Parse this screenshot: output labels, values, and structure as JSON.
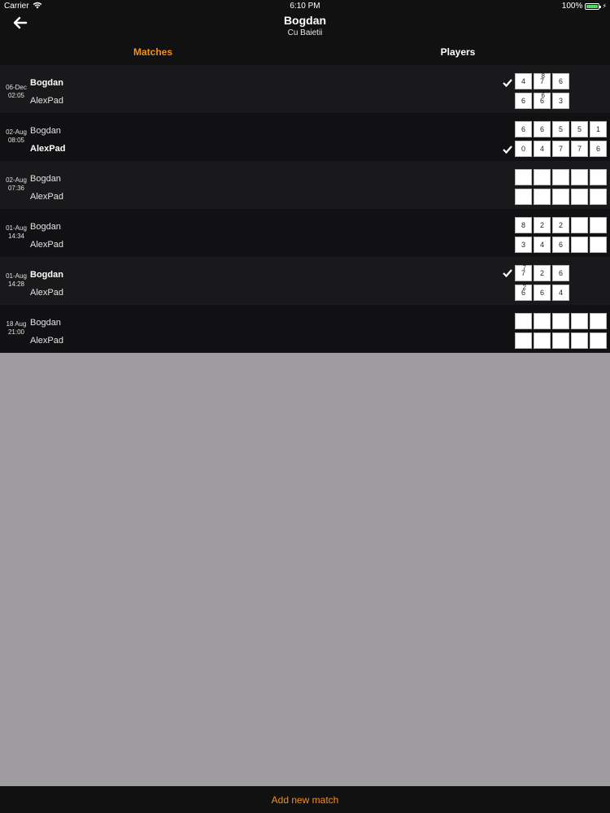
{
  "status": {
    "carrier": "Carrier",
    "time": "6:10 PM",
    "battery": "100%"
  },
  "header": {
    "title": "Bogdan",
    "subtitle": "Cu Baietii"
  },
  "tabs": [
    {
      "label": "Matches"
    },
    {
      "label": "Players"
    }
  ],
  "matches": [
    {
      "date": "06-Dec",
      "time": "02:05",
      "p1": "Bogdan",
      "p2": "AlexPad",
      "p1_sets": [
        "4",
        "7",
        "6"
      ],
      "p1_tb": [
        "",
        "8",
        ""
      ],
      "p2_sets": [
        "6",
        "6",
        "3"
      ],
      "p2_tb": [
        "",
        "6",
        ""
      ]
    },
    {
      "date": "02-Aug",
      "time": "08:05",
      "p1": "Bogdan",
      "p2": "AlexPad",
      "p1_sets": [
        "6",
        "6",
        "5",
        "5",
        "1"
      ],
      "p1_tb": [
        "",
        "",
        "",
        "",
        ""
      ],
      "p2_sets": [
        "0",
        "4",
        "7",
        "7",
        "6"
      ],
      "p2_tb": [
        "",
        "",
        "",
        "",
        ""
      ]
    },
    {
      "date": "02-Aug",
      "time": "07:36",
      "p1": "Bogdan",
      "p2": "AlexPad",
      "p1_sets": [
        "",
        "",
        "",
        "",
        ""
      ],
      "p1_tb": [
        "",
        "",
        "",
        "",
        ""
      ],
      "p2_sets": [
        "",
        "",
        "",
        "",
        ""
      ],
      "p2_tb": [
        "",
        "",
        "",
        "",
        ""
      ]
    },
    {
      "date": "01-Aug",
      "time": "14:34",
      "p1": "Bogdan",
      "p2": "AlexPad",
      "p1_sets": [
        "8",
        "2",
        "2",
        "",
        ""
      ],
      "p1_tb": [
        "",
        "",
        "",
        "",
        ""
      ],
      "p2_sets": [
        "3",
        "4",
        "6",
        "",
        ""
      ],
      "p2_tb": [
        "",
        "",
        "",
        "",
        ""
      ]
    },
    {
      "date": "01-Aug",
      "time": "14:28",
      "p1": "Bogdan",
      "p2": "AlexPad",
      "p1_sets": [
        "7",
        "2",
        "6"
      ],
      "p1_tb": [
        "7",
        "",
        ""
      ],
      "p2_sets": [
        "6",
        "6",
        "4"
      ],
      "p2_tb": [
        "2",
        "",
        ""
      ]
    },
    {
      "date": "18 Aug",
      "time": "21:00",
      "p1": "Bogdan",
      "p2": "AlexPad",
      "p1_sets": [
        "",
        "",
        "",
        "",
        ""
      ],
      "p1_tb": [
        "",
        "",
        "",
        "",
        ""
      ],
      "p2_sets": [
        "",
        "",
        "",
        "",
        ""
      ],
      "p2_tb": [
        "",
        "",
        "",
        "",
        ""
      ]
    }
  ],
  "footer": {
    "add_label": "Add new match"
  },
  "colors": {
    "accent": "#f0901d",
    "battery": "#4cd964"
  },
  "icons": {
    "back": "back-arrow-icon",
    "check": "checkmark-icon",
    "wifi": "wifi-icon",
    "battery": "battery-icon"
  }
}
